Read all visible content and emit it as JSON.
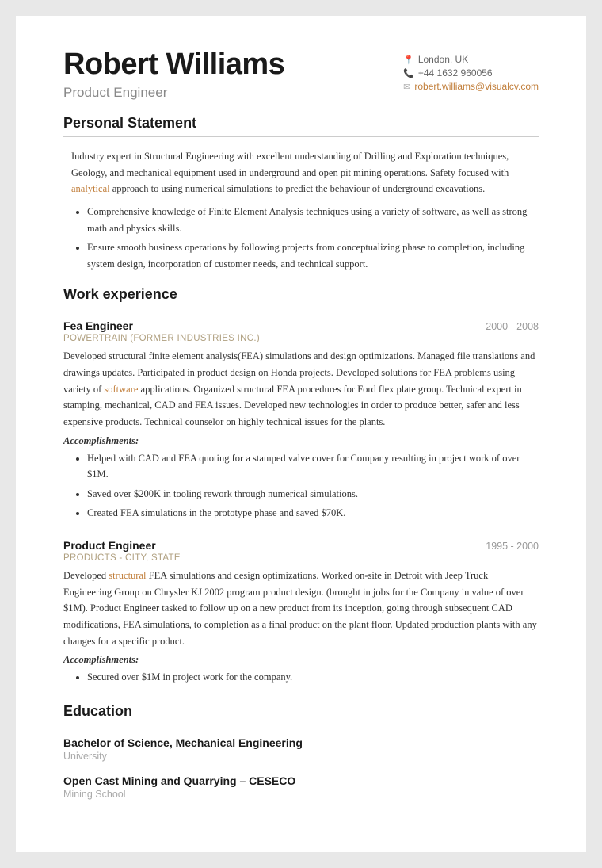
{
  "header": {
    "name": "Robert Williams",
    "title": "Product Engineer",
    "contact": {
      "location": "London, UK",
      "phone": "+44 1632 960056",
      "email": "robert.williams@visualcv.com"
    }
  },
  "sections": {
    "personal_statement": {
      "title": "Personal Statement",
      "paragraphs": [
        "Industry expert in Structural Engineering with excellent understanding of Drilling and Exploration techniques, Geology, and mechanical equipment used in underground and open pit mining operations. Safety focused with analytical approach to using numerical simulations to predict the behaviour of underground excavations."
      ],
      "bullets": [
        "Comprehensive knowledge of Finite Element Analysis techniques using a variety of software, as well as strong math and physics skills.",
        "Ensure smooth business operations by following projects from conceptualizing phase to completion, including system design, incorporation of customer needs, and technical support."
      ]
    },
    "work_experience": {
      "title": "Work experience",
      "jobs": [
        {
          "title": "Fea Engineer",
          "company": "POWERTRAIN (FORMER INDUSTRIES INC.)",
          "dates": "2000 - 2008",
          "description": "Developed structural finite element analysis(FEA) simulations and design optimizations. Managed file translations and drawings updates. Participated in product design on Honda projects. Developed solutions for FEA problems using variety of software applications. Organized structural FEA procedures for Ford flex plate group. Technical expert in stamping, mechanical, CAD and FEA issues. Developed new technologies in order to produce better, safer and less expensive products. Technical counselor on highly technical issues for the plants.",
          "accomplishments_label": "Accomplishments:",
          "accomplishments": [
            "Helped with CAD and FEA quoting for a stamped valve cover for Company resulting in project work of over $1M.",
            "Saved over $200K in tooling rework through numerical simulations.",
            "Created FEA simulations in the prototype phase and saved $70K."
          ]
        },
        {
          "title": "Product Engineer",
          "company": "PRODUCTS - CITY, STATE",
          "dates": "1995 - 2000",
          "description": "Developed structural FEA simulations and design optimizations. Worked on-site in Detroit with Jeep Truck Engineering Group on Chrysler KJ 2002 program product design. (brought in jobs for the Company in value of over $1M). Product Engineer tasked to follow up on a new product from its inception, going through subsequent CAD modifications, FEA simulations, to completion as a final product on the plant floor. Updated production plants with any changes for a specific product.",
          "accomplishments_label": "Accomplishments:",
          "accomplishments": [
            "Secured over $1M in project work for the company."
          ]
        }
      ]
    },
    "education": {
      "title": "Education",
      "items": [
        {
          "degree": "Bachelor of Science, Mechanical Engineering",
          "school": "University"
        },
        {
          "degree": "Open Cast Mining and Quarrying – CESECO",
          "school": "Mining School"
        }
      ]
    }
  }
}
